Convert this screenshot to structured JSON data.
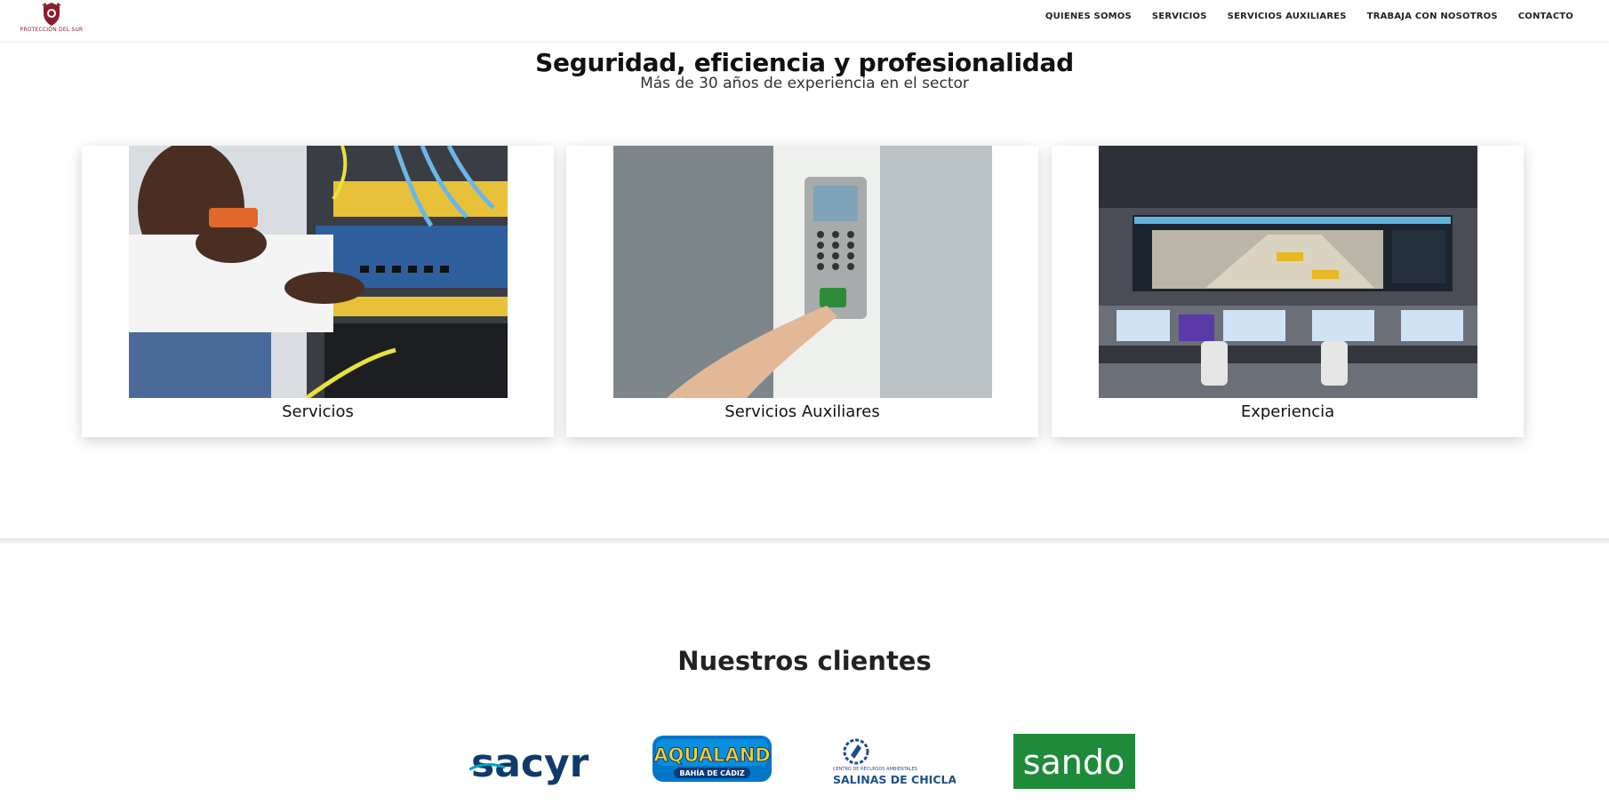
{
  "header": {
    "logo_text": "PROTECCIÓN DEL SUR",
    "nav": [
      {
        "label": "QUIENES SOMOS"
      },
      {
        "label": "SERVICIOS"
      },
      {
        "label": "SERVICIOS AUXILIARES"
      },
      {
        "label": "TRABAJA CON NOSOTROS"
      },
      {
        "label": "CONTACTO"
      }
    ]
  },
  "hero": {
    "title": "Seguridad, eficiencia y profesionalidad",
    "subtitle": "Más de 30 años de experiencia en el sector"
  },
  "cards": [
    {
      "label": "Servicios",
      "image": "technician-server-rack-photo"
    },
    {
      "label": "Servicios Auxiliares",
      "image": "fingerprint-access-control-photo"
    },
    {
      "label": "Experiencia",
      "image": "control-room-monitoring-photo"
    }
  ],
  "clients": {
    "title": "Nuestros clientes",
    "logos": [
      {
        "name": "sacyr",
        "text": "sacyr",
        "color": "#0f3a6b"
      },
      {
        "name": "aqualand",
        "text": "AQUALAND",
        "subtext": "BAHÍA DE CÁDIZ",
        "color": "#0077c8"
      },
      {
        "name": "salinas-de-chiclana",
        "text": "SALINAS DE CHICLANA",
        "subtext": "CENTRO DE RECURSOS AMBIENTALES",
        "color": "#1d4f8c"
      },
      {
        "name": "sando",
        "text": "sando",
        "color": "#1f8a3a"
      }
    ]
  },
  "colors": {
    "brand": "#8b1e2e",
    "text": "#111111"
  }
}
